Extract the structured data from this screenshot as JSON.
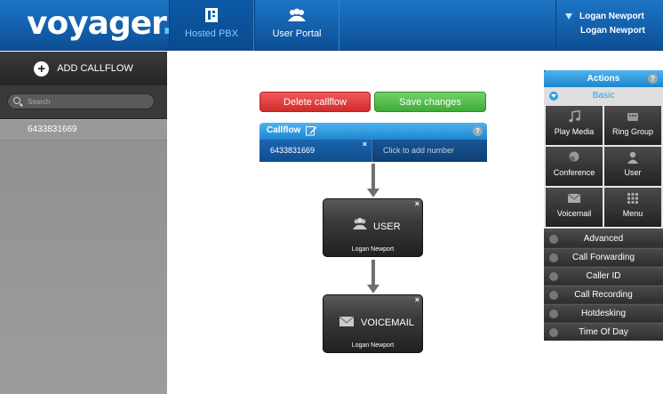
{
  "app": {
    "logo_text": "voyager",
    "logo_dot": "."
  },
  "nav": {
    "tabs": [
      {
        "label": "Hosted PBX",
        "icon": "building-icon",
        "active": true
      },
      {
        "label": "User Portal",
        "icon": "users-icon",
        "active": false
      }
    ],
    "user_name": "Logan Newport",
    "account_name": "Logan Newport"
  },
  "sidebar": {
    "add_label": "ADD CALLFLOW",
    "search_placeholder": "Search",
    "items": [
      {
        "label": "6433831669"
      }
    ]
  },
  "toolbar": {
    "delete_label": "Delete callflow",
    "save_label": "Save changes"
  },
  "callflow": {
    "title": "Callflow",
    "help": "?",
    "number": "6433831669",
    "add_number_label": "Click to add number",
    "nodes": [
      {
        "title": "USER",
        "subtitle": "Logan Newport",
        "icon": "user-icon"
      },
      {
        "title": "VOICEMAIL",
        "subtitle": "Logan Newport",
        "icon": "envelope-icon"
      }
    ]
  },
  "actions": {
    "title": "Actions",
    "help": "?",
    "basic_label": "Basic",
    "basic_items": [
      {
        "label": "Play Media",
        "icon": "music-note-icon"
      },
      {
        "label": "Ring Group",
        "icon": "ring-group-icon"
      },
      {
        "label": "Conference",
        "icon": "conference-icon"
      },
      {
        "label": "User",
        "icon": "user-icon"
      },
      {
        "label": "Voicemail",
        "icon": "envelope-icon"
      },
      {
        "label": "Menu",
        "icon": "keypad-icon"
      }
    ],
    "categories": [
      {
        "label": "Advanced"
      },
      {
        "label": "Call Forwarding"
      },
      {
        "label": "Caller ID"
      },
      {
        "label": "Call Recording"
      },
      {
        "label": "Hotdesking"
      },
      {
        "label": "Time Of Day"
      }
    ]
  },
  "colors": {
    "brand_blue": "#0c4f96",
    "accent": "#2a9fe6",
    "delete": "#d22c2c",
    "save": "#3fab37"
  }
}
